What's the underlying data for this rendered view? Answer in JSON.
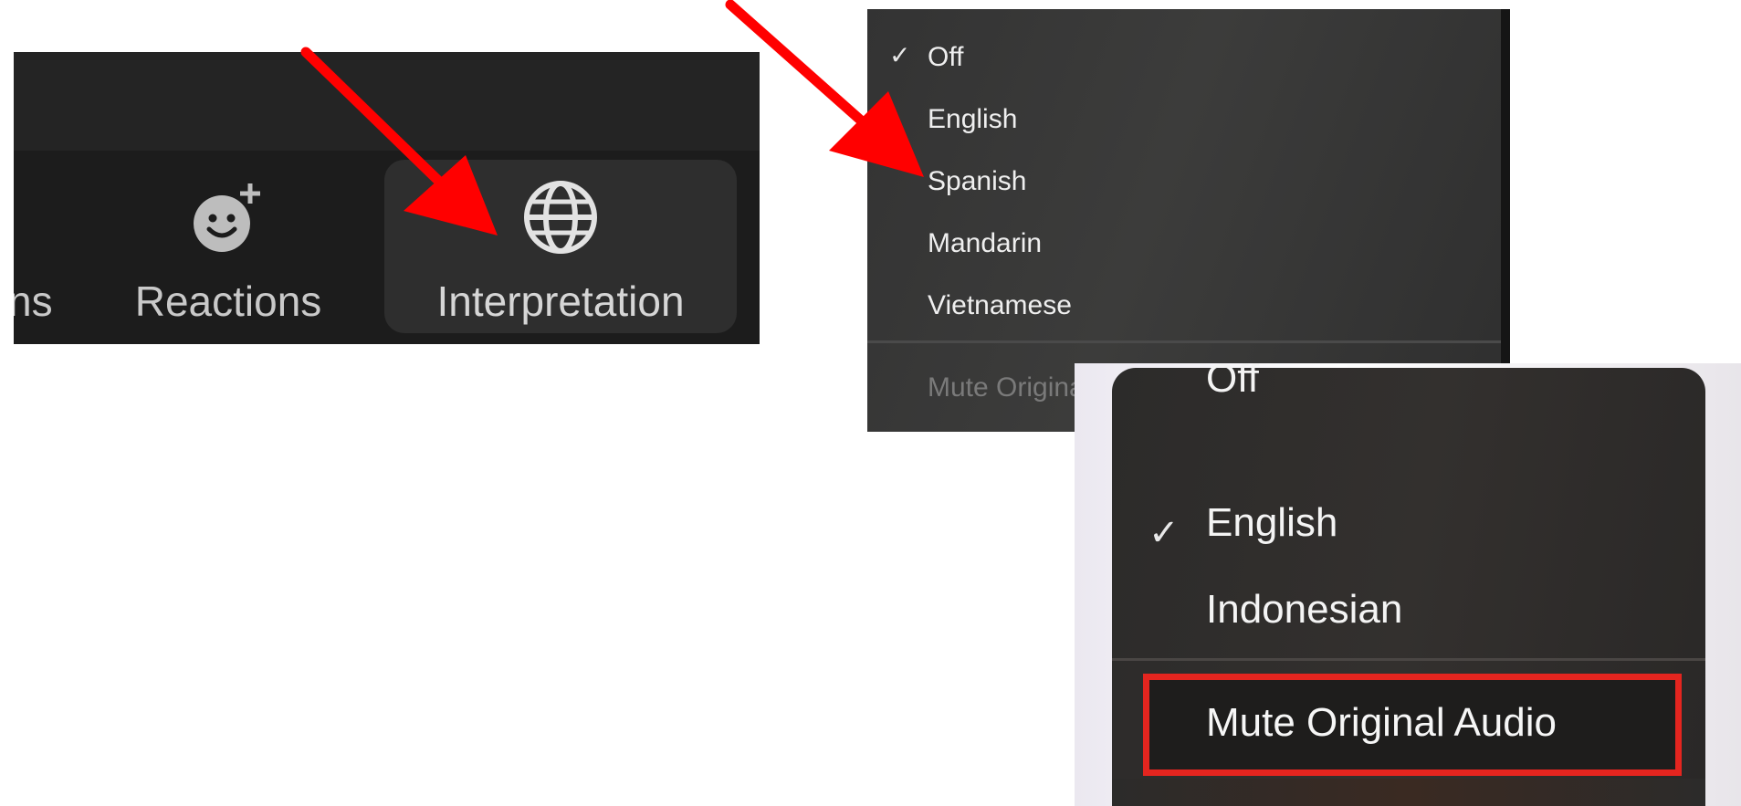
{
  "toolbar": {
    "partial_label": "ns",
    "reactions_label": "Reactions",
    "interpretation_label": "Interpretation"
  },
  "menu1": {
    "items": [
      "Off",
      "English",
      "Spanish",
      "Mandarin",
      "Vietnamese"
    ],
    "checked": "Off",
    "mute_label": "Mute Original Audio",
    "mute_disabled": true
  },
  "menu2": {
    "items": [
      "Off",
      "English",
      "Indonesian"
    ],
    "checked": "English",
    "mute_label": "Mute Original Audio",
    "highlight_color": "#e4251f"
  },
  "annotations": {
    "arrow_color": "#ff0000"
  },
  "icons": {
    "reactions": "emoji-add-icon",
    "interpretation": "globe-icon",
    "check": "checkmark-icon"
  }
}
